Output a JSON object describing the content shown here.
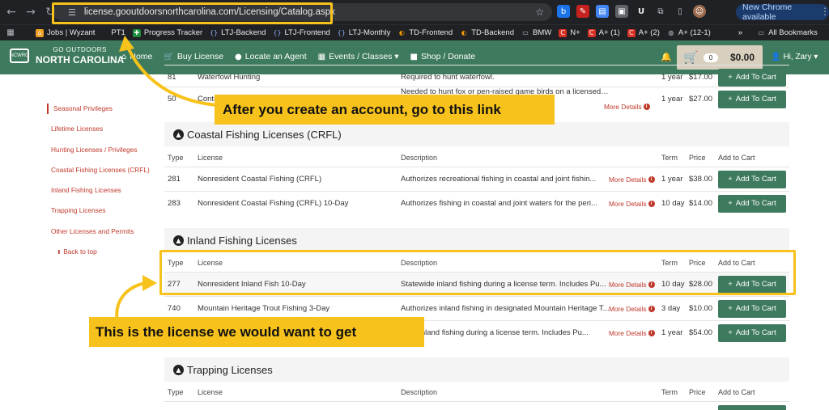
{
  "browser": {
    "url": "license.gooutdoorsnorthcarolina.com/Licensing/Catalog.aspx",
    "update_label": "New Chrome available",
    "bookmarks": [
      {
        "label": "Jobs | Wyzant"
      },
      {
        "label": "PT1"
      },
      {
        "label": "Progress Tracker"
      },
      {
        "label": "LTJ-Backend"
      },
      {
        "label": "LTJ-Frontend"
      },
      {
        "label": "LTJ-Monthly"
      },
      {
        "label": "TD-Frontend"
      },
      {
        "label": "TD-Backend"
      },
      {
        "label": "BMW"
      },
      {
        "label": "N+"
      },
      {
        "label": "A+ (1)"
      },
      {
        "label": "A+ (2)"
      },
      {
        "label": "A+ (12-1)"
      }
    ],
    "more_bookmarks": "»",
    "all_bookmarks": "All Bookmarks"
  },
  "site": {
    "logo_small": "GO OUTDOORS",
    "logo_big": "NORTH CAROLINA",
    "logo_badge": "NCWRC",
    "nav": [
      {
        "icon": "home-icon",
        "glyph": "⌂",
        "label": "Home"
      },
      {
        "icon": "cart-icon",
        "glyph": "🛒",
        "label": "Buy License"
      },
      {
        "icon": "pin-icon",
        "glyph": "●",
        "label": "Locate an Agent"
      },
      {
        "icon": "calendar-icon",
        "glyph": "▦",
        "label": "Events / Classes ▾"
      },
      {
        "icon": "shop-icon",
        "glyph": "■",
        "label": "Shop / Donate"
      }
    ],
    "cart_count": "0",
    "cart_total": "$0.00",
    "user_label": "Hi, Zary ▾"
  },
  "sidebar": {
    "items": [
      {
        "label": "Seasonal Privileges"
      },
      {
        "label": "Lifetime Licenses"
      },
      {
        "label": "Hunting Licenses / Privileges"
      },
      {
        "label": "Coastal Fishing Licenses (CRFL)"
      },
      {
        "label": "Inland Fishing Licenses"
      },
      {
        "label": "Trapping Licenses"
      },
      {
        "label": "Other Licenses and Permits"
      }
    ],
    "back_to_top": "Back to top"
  },
  "table": {
    "headers": {
      "type": "Type",
      "license": "License",
      "description": "Description",
      "term": "Term",
      "price": "Price",
      "cart": "Add to Cart"
    },
    "more_details": "More Details",
    "add_to_cart": "Add To Cart",
    "top_rows": [
      {
        "type": "81",
        "license": "Waterfowl Hunting",
        "description": "Required to hunt waterfowl.",
        "term": "1 year",
        "price": "$17.00"
      },
      {
        "type": "50",
        "license": "Contr",
        "description": "Needed to hunt fox or pen-raised game birds on a licensed c...",
        "term": "1 year",
        "price": "$27.00"
      }
    ],
    "sections": [
      {
        "title": "Coastal Fishing Licenses (CRFL)",
        "rows": [
          {
            "type": "281",
            "license": "Nonresident Coastal Fishing (CRFL)",
            "description": "Authorizes recreational fishing in coastal and joint fishin...",
            "term": "1 year",
            "price": "$38.00"
          },
          {
            "type": "283",
            "license": "Nonresident Coastal Fishing (CRFL) 10-Day",
            "description": "Authorizes fishing in coastal and joint waters for the peri...",
            "term": "10 day",
            "price": "$14.00"
          }
        ]
      },
      {
        "title": "Inland Fishing Licenses",
        "rows": [
          {
            "type": "277",
            "license": "Nonresident Inland Fish 10-Day",
            "description": "Statewide inland fishing during a license term. Includes Pu...",
            "term": "10 day",
            "price": "$28.00"
          },
          {
            "type": "740",
            "license": "Mountain Heritage Trout Fishing 3-Day",
            "description": "Authorizes inland fishing in designated Mountain Heritage T...",
            "term": "3 day",
            "price": "$10.00"
          },
          {
            "type": "",
            "license": "",
            "description": "wide Inland fishing during a license term. Includes Pu...",
            "term": "1 year",
            "price": "$54.00"
          }
        ]
      },
      {
        "title": "Trapping Licenses",
        "rows": []
      }
    ]
  },
  "annotations": {
    "callout_link": "After you create an account, go to this link",
    "callout_license": "This is the license we would want to get"
  }
}
